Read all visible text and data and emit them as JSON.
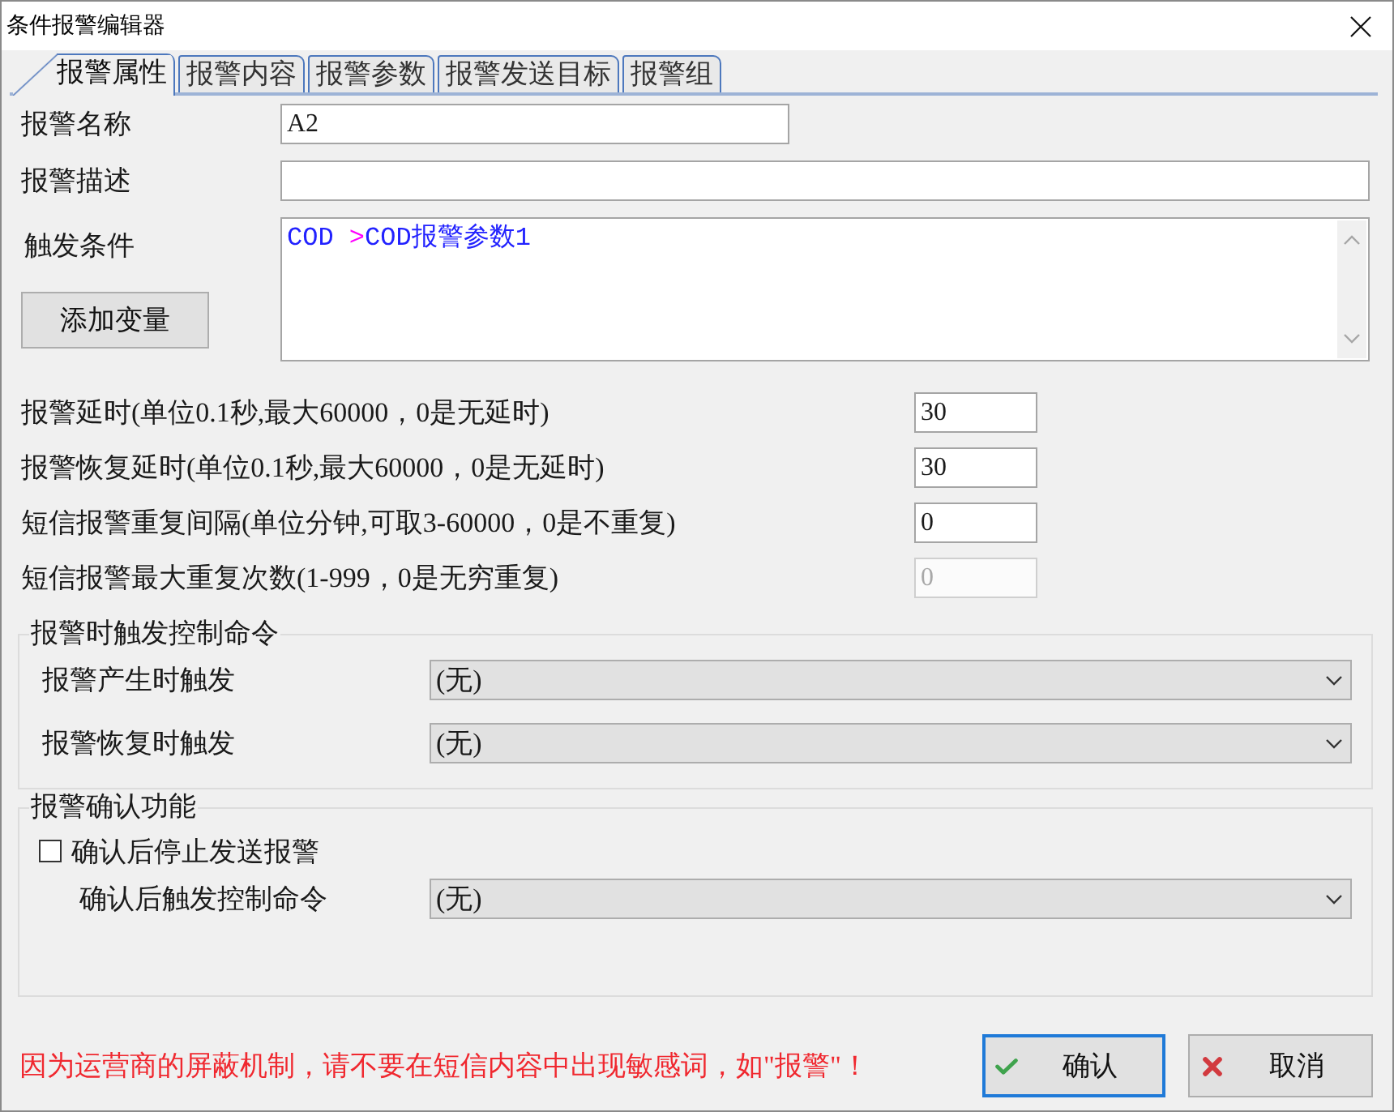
{
  "window": {
    "title": "条件报警编辑器"
  },
  "tabs": [
    {
      "label": "报警属性",
      "selected": true
    },
    {
      "label": "报警内容",
      "selected": false
    },
    {
      "label": "报警参数",
      "selected": false
    },
    {
      "label": "报警发送目标",
      "selected": false
    },
    {
      "label": "报警组",
      "selected": false
    }
  ],
  "fields": [
    {
      "label": "报警名称",
      "value": "A2",
      "kind": "short"
    },
    {
      "label": "报警描述",
      "kind": "wide"
    }
  ],
  "trigger_condition": {
    "label": "触发条件",
    "tokens": [
      {
        "text": "COD ",
        "color": "#2222ff"
      },
      {
        "text": ">",
        "color": "#ff00ff"
      },
      {
        "text": "COD报警参数1",
        "color": "#2222ff"
      }
    ],
    "add_button": "添加变量"
  },
  "timing_settings": [
    {
      "label": "报警延时(单位0.1秒,最大60000，0是无延时)",
      "value": "30",
      "disabled": false
    },
    {
      "label": "报警恢复延时(单位0.1秒,最大60000，0是无延时)",
      "value": "30",
      "disabled": false
    },
    {
      "label": "短信报警重复间隔(单位分钟,可取3-60000，0是不重复)",
      "value": "0",
      "disabled": false
    },
    {
      "label": "短信报警最大重复次数(1-999，0是无穷重复)",
      "value": "0",
      "disabled": true
    }
  ],
  "trigger_commands": {
    "title": "报警时触发控制命令",
    "rows": [
      {
        "label": "报警产生时触发",
        "value": "(无)"
      },
      {
        "label": "报警恢复时触发",
        "value": "(无)"
      }
    ]
  },
  "acknowledgement": {
    "title": "报警确认功能",
    "stop_sending": {
      "label": "确认后停止发送报警",
      "checked": false
    },
    "rows": [
      {
        "label": "确认后触发控制命令",
        "value": "(无)"
      }
    ]
  },
  "warning": "因为运营商的屏蔽机制，请不要在短信内容中出现敏感词，如\"报警\"！",
  "buttons": [
    {
      "label": "确认",
      "kind": "ok",
      "focused": true
    },
    {
      "label": "取消",
      "kind": "cancel",
      "focused": false
    }
  ]
}
